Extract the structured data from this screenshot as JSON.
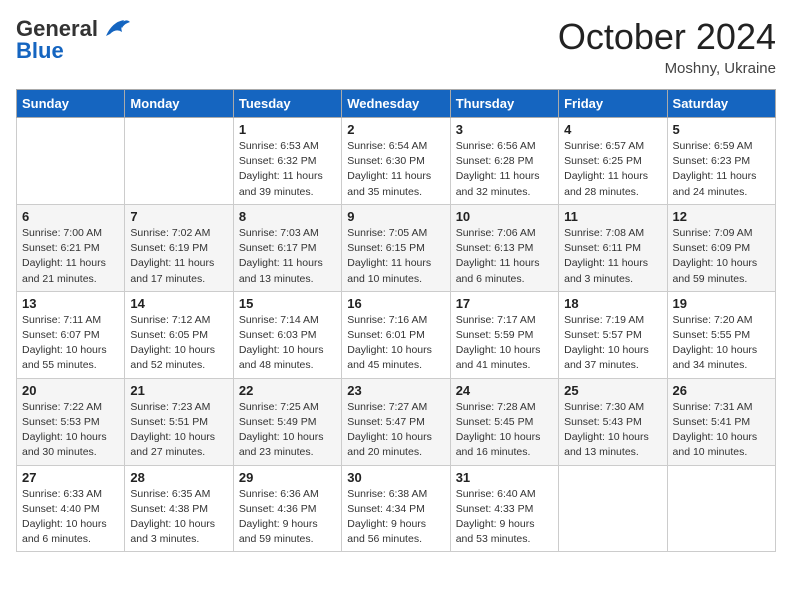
{
  "header": {
    "logo_general": "General",
    "logo_blue": "Blue",
    "month_title": "October 2024",
    "location": "Moshny, Ukraine"
  },
  "weekdays": [
    "Sunday",
    "Monday",
    "Tuesday",
    "Wednesday",
    "Thursday",
    "Friday",
    "Saturday"
  ],
  "weeks": [
    [
      {
        "day": "",
        "detail": ""
      },
      {
        "day": "",
        "detail": ""
      },
      {
        "day": "1",
        "detail": "Sunrise: 6:53 AM\nSunset: 6:32 PM\nDaylight: 11 hours and 39 minutes."
      },
      {
        "day": "2",
        "detail": "Sunrise: 6:54 AM\nSunset: 6:30 PM\nDaylight: 11 hours and 35 minutes."
      },
      {
        "day": "3",
        "detail": "Sunrise: 6:56 AM\nSunset: 6:28 PM\nDaylight: 11 hours and 32 minutes."
      },
      {
        "day": "4",
        "detail": "Sunrise: 6:57 AM\nSunset: 6:25 PM\nDaylight: 11 hours and 28 minutes."
      },
      {
        "day": "5",
        "detail": "Sunrise: 6:59 AM\nSunset: 6:23 PM\nDaylight: 11 hours and 24 minutes."
      }
    ],
    [
      {
        "day": "6",
        "detail": "Sunrise: 7:00 AM\nSunset: 6:21 PM\nDaylight: 11 hours and 21 minutes."
      },
      {
        "day": "7",
        "detail": "Sunrise: 7:02 AM\nSunset: 6:19 PM\nDaylight: 11 hours and 17 minutes."
      },
      {
        "day": "8",
        "detail": "Sunrise: 7:03 AM\nSunset: 6:17 PM\nDaylight: 11 hours and 13 minutes."
      },
      {
        "day": "9",
        "detail": "Sunrise: 7:05 AM\nSunset: 6:15 PM\nDaylight: 11 hours and 10 minutes."
      },
      {
        "day": "10",
        "detail": "Sunrise: 7:06 AM\nSunset: 6:13 PM\nDaylight: 11 hours and 6 minutes."
      },
      {
        "day": "11",
        "detail": "Sunrise: 7:08 AM\nSunset: 6:11 PM\nDaylight: 11 hours and 3 minutes."
      },
      {
        "day": "12",
        "detail": "Sunrise: 7:09 AM\nSunset: 6:09 PM\nDaylight: 10 hours and 59 minutes."
      }
    ],
    [
      {
        "day": "13",
        "detail": "Sunrise: 7:11 AM\nSunset: 6:07 PM\nDaylight: 10 hours and 55 minutes."
      },
      {
        "day": "14",
        "detail": "Sunrise: 7:12 AM\nSunset: 6:05 PM\nDaylight: 10 hours and 52 minutes."
      },
      {
        "day": "15",
        "detail": "Sunrise: 7:14 AM\nSunset: 6:03 PM\nDaylight: 10 hours and 48 minutes."
      },
      {
        "day": "16",
        "detail": "Sunrise: 7:16 AM\nSunset: 6:01 PM\nDaylight: 10 hours and 45 minutes."
      },
      {
        "day": "17",
        "detail": "Sunrise: 7:17 AM\nSunset: 5:59 PM\nDaylight: 10 hours and 41 minutes."
      },
      {
        "day": "18",
        "detail": "Sunrise: 7:19 AM\nSunset: 5:57 PM\nDaylight: 10 hours and 37 minutes."
      },
      {
        "day": "19",
        "detail": "Sunrise: 7:20 AM\nSunset: 5:55 PM\nDaylight: 10 hours and 34 minutes."
      }
    ],
    [
      {
        "day": "20",
        "detail": "Sunrise: 7:22 AM\nSunset: 5:53 PM\nDaylight: 10 hours and 30 minutes."
      },
      {
        "day": "21",
        "detail": "Sunrise: 7:23 AM\nSunset: 5:51 PM\nDaylight: 10 hours and 27 minutes."
      },
      {
        "day": "22",
        "detail": "Sunrise: 7:25 AM\nSunset: 5:49 PM\nDaylight: 10 hours and 23 minutes."
      },
      {
        "day": "23",
        "detail": "Sunrise: 7:27 AM\nSunset: 5:47 PM\nDaylight: 10 hours and 20 minutes."
      },
      {
        "day": "24",
        "detail": "Sunrise: 7:28 AM\nSunset: 5:45 PM\nDaylight: 10 hours and 16 minutes."
      },
      {
        "day": "25",
        "detail": "Sunrise: 7:30 AM\nSunset: 5:43 PM\nDaylight: 10 hours and 13 minutes."
      },
      {
        "day": "26",
        "detail": "Sunrise: 7:31 AM\nSunset: 5:41 PM\nDaylight: 10 hours and 10 minutes."
      }
    ],
    [
      {
        "day": "27",
        "detail": "Sunrise: 6:33 AM\nSunset: 4:40 PM\nDaylight: 10 hours and 6 minutes."
      },
      {
        "day": "28",
        "detail": "Sunrise: 6:35 AM\nSunset: 4:38 PM\nDaylight: 10 hours and 3 minutes."
      },
      {
        "day": "29",
        "detail": "Sunrise: 6:36 AM\nSunset: 4:36 PM\nDaylight: 9 hours and 59 minutes."
      },
      {
        "day": "30",
        "detail": "Sunrise: 6:38 AM\nSunset: 4:34 PM\nDaylight: 9 hours and 56 minutes."
      },
      {
        "day": "31",
        "detail": "Sunrise: 6:40 AM\nSunset: 4:33 PM\nDaylight: 9 hours and 53 minutes."
      },
      {
        "day": "",
        "detail": ""
      },
      {
        "day": "",
        "detail": ""
      }
    ]
  ]
}
